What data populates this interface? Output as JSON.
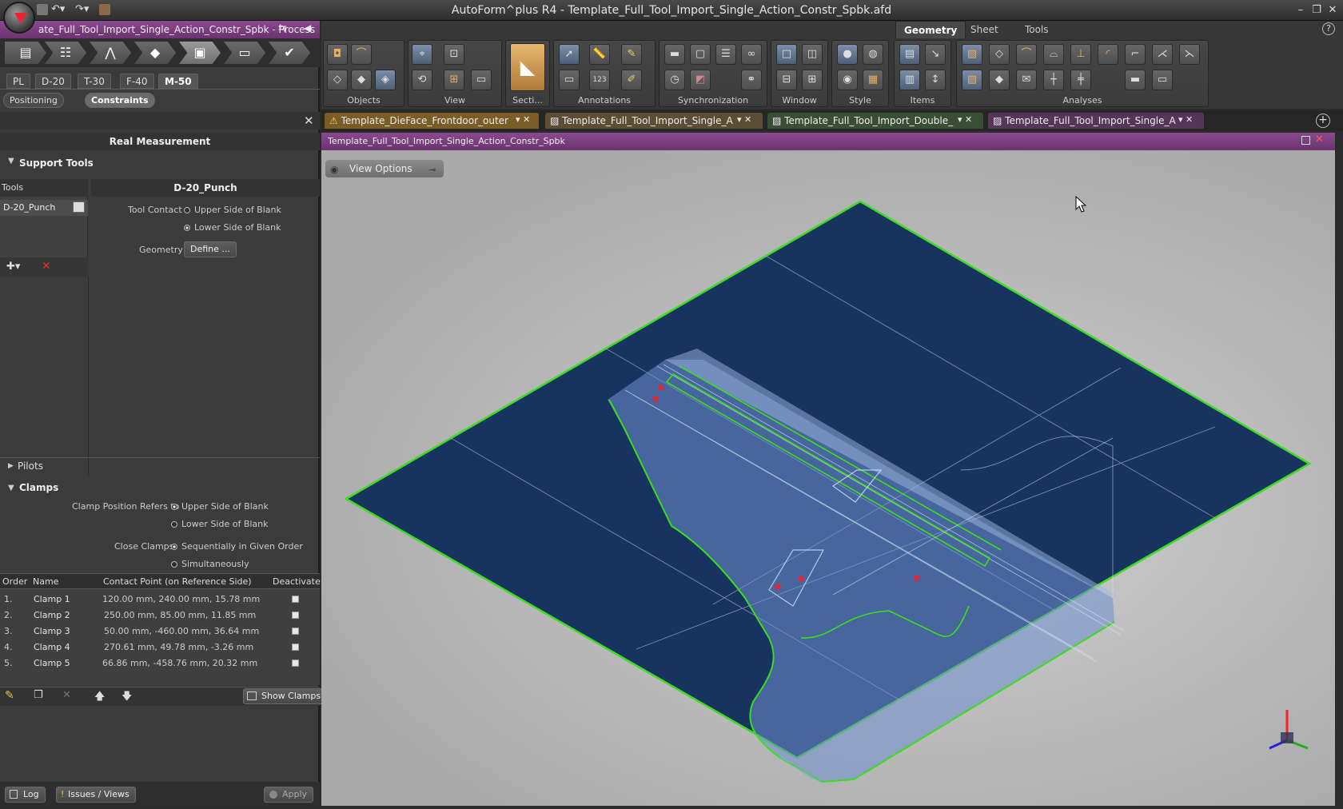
{
  "app": {
    "window_title": "AutoForm^plus R4 - Template_Full_Tool_Import_Single_Action_Constr_Spbk.afd",
    "project_title": "ate_Full_Tool_Import_Single_Action_Constr_Spbk  - Process"
  },
  "stages": [
    "PL",
    "D-20",
    "T-30",
    "F-40",
    "M-50"
  ],
  "subtabs": [
    "Positioning",
    "Constraints"
  ],
  "panel": {
    "header": "Real Measurement",
    "support_tools": {
      "title": "Support Tools",
      "tools_col_header": "Tools",
      "tool_item": "D-20_Punch",
      "detail_header": "D-20_Punch",
      "tool_contact_label": "Tool Contact",
      "upper_side": "Upper Side of Blank",
      "lower_side": "Lower Side of Blank",
      "geometry_label": "Geometry",
      "define_button": "Define ..."
    },
    "pilots": "Pilots",
    "clamps": {
      "title": "Clamps",
      "position_label": "Clamp Position Refers to",
      "upper_side": "Upper Side of Blank",
      "lower_side": "Lower Side of Blank",
      "close_label": "Close Clamps",
      "sequential": "Sequentially in Given Order",
      "simultaneous": "Simultaneously",
      "columns": [
        "Order",
        "Name",
        "Contact Point (on Reference Side)",
        "Deactivate"
      ],
      "rows": [
        {
          "order": "1.",
          "name": "Clamp 1",
          "point": "120.00 mm, 240.00 mm, 15.78 mm"
        },
        {
          "order": "2.",
          "name": "Clamp 2",
          "point": "250.00 mm, 85.00 mm, 11.85 mm"
        },
        {
          "order": "3.",
          "name": "Clamp 3",
          "point": "50.00 mm, -460.00 mm, 36.64 mm"
        },
        {
          "order": "4.",
          "name": "Clamp 4",
          "point": "270.61 mm, 49.78 mm, -3.26 mm"
        },
        {
          "order": "5.",
          "name": "Clamp 5",
          "point": "66.86 mm, -458.76 mm, 20.32 mm"
        }
      ],
      "show_clamps": "Show Clamps"
    }
  },
  "bottom": {
    "log": "Log",
    "issues": "Issues / Views",
    "apply": "Apply"
  },
  "ribbon": {
    "context_tabs": [
      "Geometry",
      "Sheet",
      "Tools"
    ],
    "groups": [
      "Objects",
      "View",
      "Secti...",
      "Annotations",
      "Synchronization",
      "Window",
      "Style",
      "Items",
      "Analyses"
    ]
  },
  "doc_tabs": [
    {
      "label": "Template_DieFace_Frontdoor_outer",
      "color": "#8a6a2a"
    },
    {
      "label": "Template_Full_Tool_Import_Single_A",
      "color": "#6a5a3a"
    },
    {
      "label": "Template_Full_Tool_Import_Double_",
      "color": "#3f5a3a"
    },
    {
      "label": "Template_Full_Tool_Import_Single_A",
      "color": "#5a3a5e"
    }
  ],
  "view": {
    "header": "Template_Full_Tool_Import_Single_Action_Constr_Spbk",
    "view_options": "View Options",
    "blank_color": "#17335f",
    "outline_color": "#3cdc1e",
    "part_color": "#6d90cf"
  }
}
